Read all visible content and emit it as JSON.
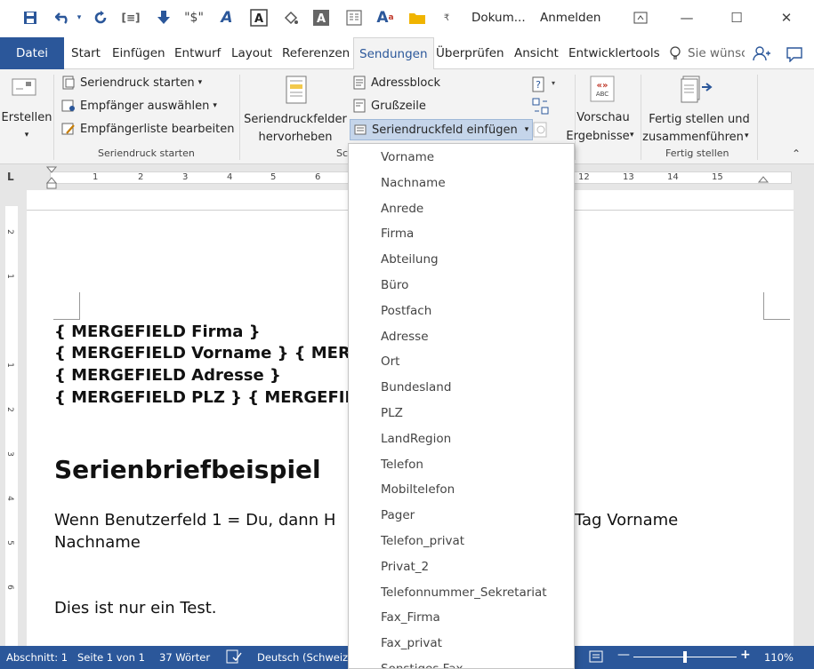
{
  "qat": {
    "doc_title": "Dokum...",
    "signin": "Anmelden",
    "minimize": "—",
    "maximize": "☐",
    "close": "✕"
  },
  "tabs": {
    "file": "Datei",
    "start": "Start",
    "insert": "Einfügen",
    "design": "Entwurf",
    "layout": "Layout",
    "references": "Referenzen",
    "mailings": "Sendungen",
    "review": "Überprüfen",
    "view": "Ansicht",
    "developer": "Entwicklertools",
    "tell_me": "Sie wünsc"
  },
  "ribbon": {
    "create": "Erstellen",
    "start_merge": "Seriendruck starten",
    "select_recipients": "Empfänger auswählen",
    "edit_list": "Empfängerliste bearbeiten",
    "group_start": "Seriendruck starten",
    "highlight_1": "Seriendruckfelder",
    "highlight_2": "hervorheben",
    "address_block": "Adressblock",
    "greeting": "Grußzeile",
    "insert_field": "Seriendruckfeld einfügen",
    "group_write": "Sc",
    "preview_1": "Vorschau",
    "preview_2": "Ergebnisse",
    "finish_1": "Fertig stellen und",
    "finish_2": "zusammenführen",
    "group_finish": "Fertig stellen"
  },
  "ruler": {
    "left_ticks": [
      "1",
      "2",
      "3",
      "4",
      "5",
      "6"
    ],
    "right_ticks": [
      "12",
      "13",
      "14",
      "15"
    ],
    "v_ticks": [
      "2",
      "1",
      "1",
      "2",
      "3",
      "4",
      "5",
      "6"
    ]
  },
  "document": {
    "line1": "{ MERGEFIELD Firma }",
    "line2": "{ MERGEFIELD Vorname } { MERGEFIELD",
    "line3": "{ MERGEFIELD Adresse }",
    "line4": "{ MERGEFIELD PLZ } { MERGEFIELD",
    "heading": "Serienbriefbeispiel",
    "para1_left": "Wenn Benutzerfeld 1 = Du, dann H",
    "para1_right": "Tag Vorname",
    "para1_line2": "Nachname",
    "para2": "Dies ist nur ein Test."
  },
  "dropdown": {
    "items": [
      "Vorname",
      "Nachname",
      "Anrede",
      "Firma",
      "Abteilung",
      "Büro",
      "Postfach",
      "Adresse",
      "Ort",
      "Bundesland",
      "PLZ",
      "LandRegion",
      "Telefon",
      "Mobiltelefon",
      "Pager",
      "Telefon_privat",
      "Privat_2",
      "Telefonnummer_Sekretariat",
      "Fax_Firma",
      "Fax_privat",
      "Sonstiges Fax"
    ]
  },
  "status": {
    "section": "Abschnitt: 1",
    "page": "Seite 1 von 1",
    "words": "37 Wörter",
    "language": "Deutsch (Schweiz)",
    "zoom": "110%",
    "zoom_minus": "—",
    "zoom_plus": "+"
  },
  "colors": {
    "accent": "#2b579a",
    "ribbon_bg": "#f3f3f3"
  }
}
